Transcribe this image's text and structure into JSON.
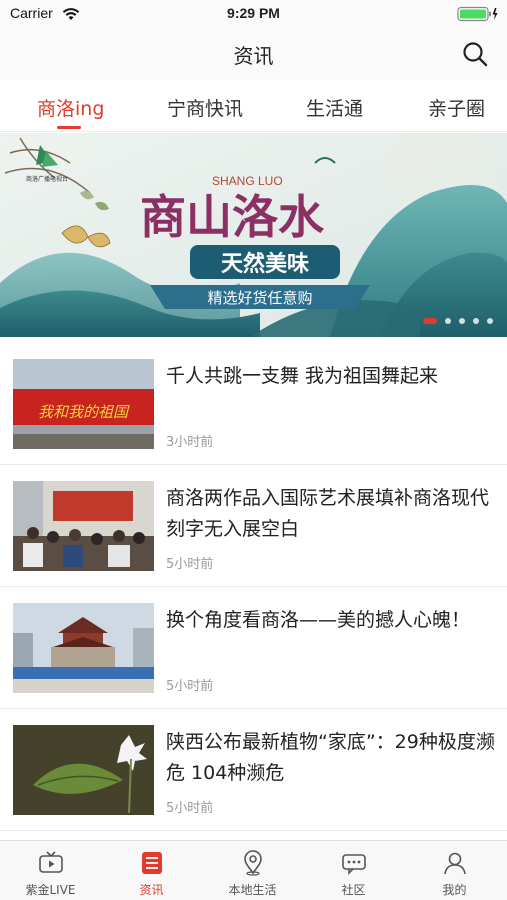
{
  "status_bar": {
    "carrier": "Carrier",
    "time": "9:29 PM"
  },
  "nav": {
    "title": "资讯",
    "search_icon": "search-icon"
  },
  "tabs": [
    {
      "label": "商洛ing",
      "active": true
    },
    {
      "label": "宁商快讯",
      "active": false
    },
    {
      "label": "生活通",
      "active": false
    },
    {
      "label": "亲子圈",
      "active": false
    }
  ],
  "banner": {
    "logo_text": "商洛广播电视台",
    "subtitle_en": "SHANG LUO",
    "headline": "商山洛水",
    "ribbon": "天然美味",
    "tagline": "精选好货任意购",
    "page_count": 5,
    "active_index": 0
  },
  "news": [
    {
      "title": "千人共跳一支舞 我为祖国舞起来",
      "time": "3小时前",
      "thumb_caption": "我和我的祖国"
    },
    {
      "title": "商洛两作品入国际艺术展填补商洛现代刻字无入展空白",
      "time": "5小时前"
    },
    {
      "title": "换个角度看商洛——美的撼人心魄！",
      "time": "5小时前"
    },
    {
      "title": "陕西公布最新植物“家底”：29种极度濒危 104种濒危",
      "time": "5小时前"
    }
  ],
  "tab_bar": [
    {
      "label": "紫金LIVE",
      "icon": "tv-icon",
      "active": false
    },
    {
      "label": "资讯",
      "icon": "news-icon",
      "active": true
    },
    {
      "label": "本地生活",
      "icon": "location-pin-icon",
      "active": false
    },
    {
      "label": "社区",
      "icon": "chat-bubble-icon",
      "active": false
    },
    {
      "label": "我的",
      "icon": "person-icon",
      "active": false
    }
  ],
  "colors": {
    "accent": "#e03c2c",
    "text": "#222222",
    "muted": "#9a9a9a"
  }
}
